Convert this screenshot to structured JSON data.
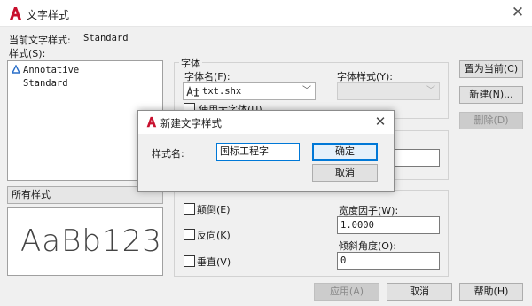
{
  "window": {
    "title": "文字样式",
    "close_glyph": "✕"
  },
  "current_style": {
    "label": "当前文字样式:",
    "value": "Standard"
  },
  "styles": {
    "label": "样式(S):",
    "items": [
      {
        "name": "Annotative",
        "icon": "annotative-icon"
      },
      {
        "name": "Standard",
        "icon": ""
      }
    ],
    "filter_label": "所有样式"
  },
  "font": {
    "group_label": "字体",
    "font_name_label": "字体名(F):",
    "font_name_value": "txt.shx",
    "font_style_label": "字体样式(Y):",
    "font_style_value": "",
    "use_bigfont_label": "使用大字体(U)"
  },
  "effects": {
    "upside_down_label": "颠倒(E)",
    "backwards_label": "反向(K)",
    "vertical_label": "垂直(V)",
    "width_factor_label": "宽度因子(W):",
    "width_factor_value": "1.0000",
    "oblique_angle_label": "倾斜角度(O):",
    "oblique_angle_value": "0"
  },
  "preview": {
    "sample_text": "AaBb123"
  },
  "buttons": {
    "set_current": "置为当前(C)",
    "new": "新建(N)...",
    "delete": "删除(D)",
    "apply": "应用(A)",
    "cancel": "取消",
    "help": "帮助(H)"
  },
  "new_style_dialog": {
    "title": "新建文字样式",
    "close_glyph": "✕",
    "name_label": "样式名:",
    "name_value": "国标工程字",
    "ok": "确定",
    "cancel": "取消"
  },
  "colors": {
    "brand_red": "#c8102e",
    "focus_blue": "#0078d7"
  }
}
